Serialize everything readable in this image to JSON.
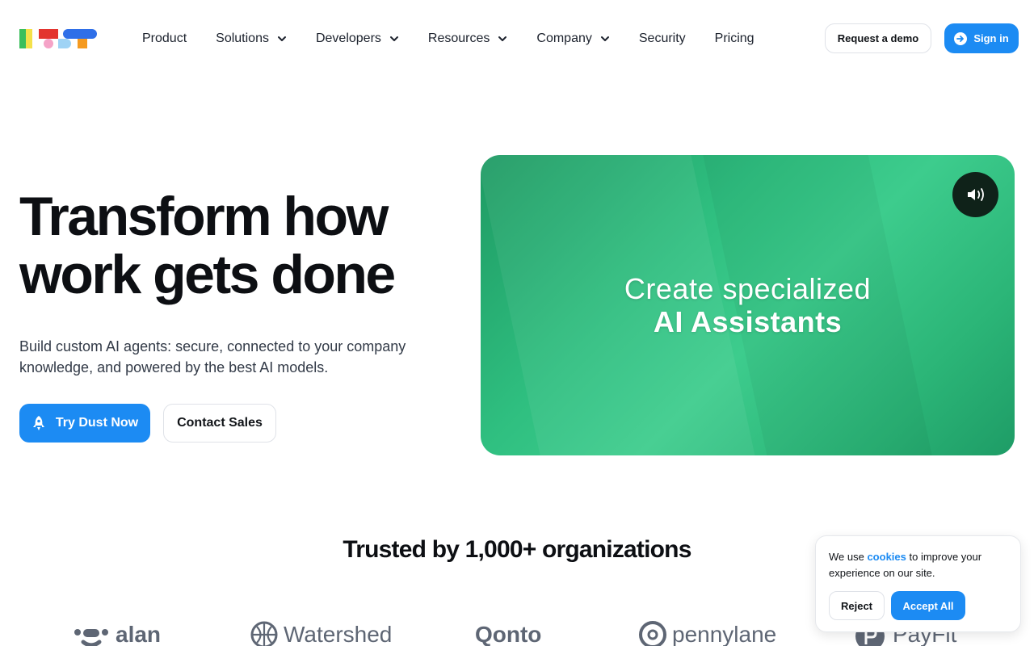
{
  "header": {
    "nav": [
      {
        "label": "Product",
        "icon": ""
      },
      {
        "label": "Solutions",
        "icon": "chevron-down-icon"
      },
      {
        "label": "Developers",
        "icon": "chevron-down-icon"
      },
      {
        "label": "Resources",
        "icon": "chevron-down-icon"
      },
      {
        "label": "Company",
        "icon": "chevron-down-icon"
      },
      {
        "label": "Security",
        "icon": ""
      },
      {
        "label": "Pricing",
        "icon": ""
      }
    ],
    "request_demo_label": "Request a demo",
    "sign_in_label": "Sign in",
    "sign_in_icon": "arrow-right-circle-icon"
  },
  "hero": {
    "title_line1": "Transform how",
    "title_line2": "work gets done",
    "subtitle": "Build custom AI agents: secure, connected to your company knowledge, and powered by the best AI models.",
    "try_label": "Try Dust Now",
    "try_icon": "rocket-icon",
    "contact_label": "Contact Sales"
  },
  "video": {
    "line1": "Create specialized",
    "line2": "AI Assistants",
    "sound_icon": "speaker-icon",
    "background_color": "#2fbf80"
  },
  "trusted": {
    "heading": "Trusted by 1,000+ organizations",
    "brands": [
      "alan",
      "Watershed",
      "Qonto",
      "pennylane",
      "PayFit"
    ]
  },
  "cookie": {
    "text_before": "We use ",
    "link": "cookies",
    "text_after": " to improve your experience on our site.",
    "reject_label": "Reject",
    "accept_label": "Accept All"
  },
  "colors": {
    "accent": "#1c8bf3",
    "text": "#0d0f13"
  }
}
